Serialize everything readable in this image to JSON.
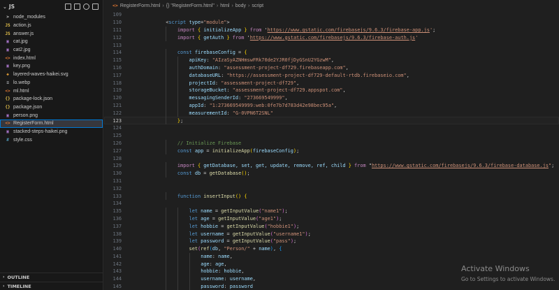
{
  "sidebar": {
    "folder": "JS",
    "files": [
      {
        "icon": ">",
        "kind": "folder",
        "name": "node_modules"
      },
      {
        "icon": "JS",
        "kind": "js",
        "name": "action.js"
      },
      {
        "icon": "JS",
        "kind": "js",
        "name": "answer.js"
      },
      {
        "icon": "▣",
        "kind": "img",
        "name": "cat.jpg"
      },
      {
        "icon": "▣",
        "kind": "img",
        "name": "cat2.jpg"
      },
      {
        "icon": "<>",
        "kind": "html",
        "name": "index.html"
      },
      {
        "icon": "▣",
        "kind": "img",
        "name": "key.png"
      },
      {
        "icon": "◈",
        "kind": "svg",
        "name": "layered-waves-haikei.svg"
      },
      {
        "icon": "≡",
        "kind": "generic",
        "name": "lo.webp"
      },
      {
        "icon": "<>",
        "kind": "html",
        "name": "ml.html"
      },
      {
        "icon": "{}",
        "kind": "json",
        "name": "package-lock.json"
      },
      {
        "icon": "{}",
        "kind": "json",
        "name": "package.json"
      },
      {
        "icon": "▣",
        "kind": "img",
        "name": "person.png"
      },
      {
        "icon": "<>",
        "kind": "html",
        "name": "RegisterForm.html",
        "active": true
      },
      {
        "icon": "▣",
        "kind": "img",
        "name": "stacked-steps-haikei.png"
      },
      {
        "icon": "#",
        "kind": "css",
        "name": "style.css"
      }
    ],
    "outline": "OUTLINE",
    "timeline": "TIMELINE"
  },
  "breadcrumb": {
    "file": "RegisterForm.html",
    "sym": "{} \"RegisterForm.html\"",
    "html": "html",
    "body": "body",
    "script": "script"
  },
  "code": {
    "current_line": 123,
    "lines": [
      {
        "n": 109,
        "indent": 0,
        "tokens": []
      },
      {
        "n": 110,
        "indent": 4,
        "tokens": [
          [
            "t-punc",
            "<"
          ],
          [
            "t-tag",
            "script"
          ],
          [
            "t-punc",
            " "
          ],
          [
            "t-attr",
            "type"
          ],
          [
            "t-punc",
            "="
          ],
          [
            "t-str",
            "\"module\""
          ],
          [
            "t-punc",
            ">"
          ]
        ]
      },
      {
        "n": 111,
        "indent": 6,
        "tokens": [
          [
            "t-kw",
            "import"
          ],
          [
            "t-punc",
            " "
          ],
          [
            "t-brk",
            "{"
          ],
          [
            "t-punc",
            " "
          ],
          [
            "t-var",
            "initializeApp"
          ],
          [
            "t-punc",
            " "
          ],
          [
            "t-brk",
            "}"
          ],
          [
            "t-punc",
            " "
          ],
          [
            "t-kw",
            "from"
          ],
          [
            "t-punc",
            " '"
          ],
          [
            "t-str link",
            "https://www.gstatic.com/firebasejs/9.6.3/firebase-app.js"
          ],
          [
            "t-str",
            "'"
          ],
          [
            "t-punc",
            ";"
          ]
        ]
      },
      {
        "n": 112,
        "indent": 6,
        "tokens": [
          [
            "t-kw",
            "import"
          ],
          [
            "t-punc",
            " "
          ],
          [
            "t-brk",
            "{"
          ],
          [
            "t-punc",
            " "
          ],
          [
            "t-var",
            "getAuth"
          ],
          [
            "t-punc",
            " "
          ],
          [
            "t-brk",
            "}"
          ],
          [
            "t-punc",
            " "
          ],
          [
            "t-kw",
            "from"
          ],
          [
            "t-punc",
            " '"
          ],
          [
            "t-str link",
            "https://www.gstatic.com/firebasejs/9.6.3/firebase-auth.js"
          ],
          [
            "t-str",
            "'"
          ]
        ]
      },
      {
        "n": 113,
        "indent": 0,
        "tokens": []
      },
      {
        "n": 114,
        "indent": 6,
        "tokens": [
          [
            "t-dec",
            "const"
          ],
          [
            "t-punc",
            " "
          ],
          [
            "t-var",
            "firebaseConfig"
          ],
          [
            "t-punc",
            " = "
          ],
          [
            "t-brk",
            "{"
          ]
        ]
      },
      {
        "n": 115,
        "indent": 8,
        "tokens": [
          [
            "t-var",
            "apiKey"
          ],
          [
            "t-punc",
            ": "
          ],
          [
            "t-str",
            "\"AIzaSyAZNHmswFRk70de2YJR0fjDyGSnU2YGzwM\""
          ],
          [
            "t-punc",
            ","
          ]
        ]
      },
      {
        "n": 116,
        "indent": 8,
        "tokens": [
          [
            "t-var",
            "authDomain"
          ],
          [
            "t-punc",
            ": "
          ],
          [
            "t-str",
            "\"assessment-project-df729.firebaseapp.com\""
          ],
          [
            "t-punc",
            ","
          ]
        ]
      },
      {
        "n": 117,
        "indent": 8,
        "tokens": [
          [
            "t-var",
            "databaseURL"
          ],
          [
            "t-punc",
            ": "
          ],
          [
            "t-str",
            "\"https://assessment-project-df729-default-rtdb.firebaseio.com\""
          ],
          [
            "t-punc",
            ","
          ]
        ]
      },
      {
        "n": 118,
        "indent": 8,
        "tokens": [
          [
            "t-var",
            "projectId"
          ],
          [
            "t-punc",
            ": "
          ],
          [
            "t-str",
            "\"assessment-project-df729\""
          ],
          [
            "t-punc",
            ","
          ]
        ]
      },
      {
        "n": 119,
        "indent": 8,
        "tokens": [
          [
            "t-var",
            "storageBucket"
          ],
          [
            "t-punc",
            ": "
          ],
          [
            "t-str",
            "\"assessment-project-df729.appspot.com\""
          ],
          [
            "t-punc",
            ","
          ]
        ]
      },
      {
        "n": 120,
        "indent": 8,
        "tokens": [
          [
            "t-var",
            "messagingSenderId"
          ],
          [
            "t-punc",
            ": "
          ],
          [
            "t-str",
            "\"273669549999\""
          ],
          [
            "t-punc",
            ","
          ]
        ]
      },
      {
        "n": 121,
        "indent": 8,
        "tokens": [
          [
            "t-var",
            "appId"
          ],
          [
            "t-punc",
            ": "
          ],
          [
            "t-str",
            "\"1:273669549999:web:0fe7b7d783d42e98bec95a\""
          ],
          [
            "t-punc",
            ","
          ]
        ]
      },
      {
        "n": 122,
        "indent": 8,
        "tokens": [
          [
            "t-var",
            "measurementId"
          ],
          [
            "t-punc",
            ": "
          ],
          [
            "t-str",
            "\"G-0VPN6T2SNL\""
          ]
        ]
      },
      {
        "n": 123,
        "indent": 6,
        "tokens": [
          [
            "t-brk",
            "}"
          ],
          [
            "t-punc",
            ";"
          ]
        ]
      },
      {
        "n": 124,
        "indent": 0,
        "tokens": []
      },
      {
        "n": 125,
        "indent": 0,
        "tokens": []
      },
      {
        "n": 126,
        "indent": 6,
        "tokens": [
          [
            "t-com",
            "// Initialize Firebase"
          ]
        ]
      },
      {
        "n": 127,
        "indent": 6,
        "tokens": [
          [
            "t-dec",
            "const"
          ],
          [
            "t-punc",
            " "
          ],
          [
            "t-var",
            "app"
          ],
          [
            "t-punc",
            " = "
          ],
          [
            "t-fn",
            "initializeApp"
          ],
          [
            "t-brk",
            "("
          ],
          [
            "t-var",
            "firebaseConfig"
          ],
          [
            "t-brk",
            ")"
          ],
          [
            "t-punc",
            ";"
          ]
        ]
      },
      {
        "n": 128,
        "indent": 0,
        "tokens": []
      },
      {
        "n": 129,
        "indent": 6,
        "tokens": [
          [
            "t-kw",
            "import"
          ],
          [
            "t-punc",
            " "
          ],
          [
            "t-brk",
            "{"
          ],
          [
            "t-punc",
            " "
          ],
          [
            "t-var",
            "getDatabase, set, get, update, remove, ref, child"
          ],
          [
            "t-punc",
            " "
          ],
          [
            "t-brk",
            "}"
          ],
          [
            "t-punc",
            " "
          ],
          [
            "t-kw",
            "from"
          ],
          [
            "t-punc",
            " \""
          ],
          [
            "t-str link",
            "https://www.gstatic.com/firebasejs/9.6.3/firebase-database.js"
          ],
          [
            "t-str",
            "\""
          ],
          [
            "t-punc",
            ";"
          ]
        ]
      },
      {
        "n": 130,
        "indent": 6,
        "tokens": [
          [
            "t-dec",
            "const"
          ],
          [
            "t-punc",
            " "
          ],
          [
            "t-var",
            "db"
          ],
          [
            "t-punc",
            " = "
          ],
          [
            "t-fn",
            "getDatabase"
          ],
          [
            "t-brk",
            "()"
          ],
          [
            "t-punc",
            ";"
          ]
        ]
      },
      {
        "n": 131,
        "indent": 0,
        "tokens": []
      },
      {
        "n": 132,
        "indent": 0,
        "tokens": []
      },
      {
        "n": 133,
        "indent": 6,
        "tokens": [
          [
            "t-dec",
            "function"
          ],
          [
            "t-punc",
            " "
          ],
          [
            "t-fn",
            "insertInput"
          ],
          [
            "t-brk",
            "()"
          ],
          [
            "t-punc",
            " "
          ],
          [
            "t-brk",
            "{"
          ]
        ]
      },
      {
        "n": 134,
        "indent": 0,
        "tokens": []
      },
      {
        "n": 135,
        "indent": 8,
        "tokens": [
          [
            "t-dec",
            "let"
          ],
          [
            "t-punc",
            " "
          ],
          [
            "t-var",
            "name"
          ],
          [
            "t-punc",
            " = "
          ],
          [
            "t-fn",
            "getInputValue"
          ],
          [
            "t-brk2",
            "("
          ],
          [
            "t-str",
            "\"name1\""
          ],
          [
            "t-brk2",
            ")"
          ],
          [
            "t-punc",
            ";"
          ]
        ]
      },
      {
        "n": 136,
        "indent": 8,
        "tokens": [
          [
            "t-dec",
            "let"
          ],
          [
            "t-punc",
            " "
          ],
          [
            "t-var",
            "age"
          ],
          [
            "t-punc",
            " = "
          ],
          [
            "t-fn",
            "getInputValue"
          ],
          [
            "t-brk2",
            "("
          ],
          [
            "t-str",
            "\"age1\""
          ],
          [
            "t-brk2",
            ")"
          ],
          [
            "t-punc",
            ";"
          ]
        ]
      },
      {
        "n": 137,
        "indent": 8,
        "tokens": [
          [
            "t-dec",
            "let"
          ],
          [
            "t-punc",
            " "
          ],
          [
            "t-var",
            "hobbie"
          ],
          [
            "t-punc",
            " = "
          ],
          [
            "t-fn",
            "getInputValue"
          ],
          [
            "t-brk2",
            "("
          ],
          [
            "t-str",
            "\"hobbie1\""
          ],
          [
            "t-brk2",
            ")"
          ],
          [
            "t-punc",
            ";"
          ]
        ]
      },
      {
        "n": 138,
        "indent": 8,
        "tokens": [
          [
            "t-dec",
            "let"
          ],
          [
            "t-punc",
            " "
          ],
          [
            "t-var",
            "username"
          ],
          [
            "t-punc",
            " = "
          ],
          [
            "t-fn",
            "getInputValue"
          ],
          [
            "t-brk2",
            "("
          ],
          [
            "t-str",
            "\"username1\""
          ],
          [
            "t-brk2",
            ")"
          ],
          [
            "t-punc",
            ";"
          ]
        ]
      },
      {
        "n": 139,
        "indent": 8,
        "tokens": [
          [
            "t-dec",
            "let"
          ],
          [
            "t-punc",
            " "
          ],
          [
            "t-var",
            "password"
          ],
          [
            "t-punc",
            " = "
          ],
          [
            "t-fn",
            "getInputValue"
          ],
          [
            "t-brk2",
            "("
          ],
          [
            "t-str",
            "\"pass\""
          ],
          [
            "t-brk2",
            ")"
          ],
          [
            "t-punc",
            ";"
          ]
        ]
      },
      {
        "n": 140,
        "indent": 8,
        "tokens": [
          [
            "t-fn",
            "set"
          ],
          [
            "t-brk2",
            "("
          ],
          [
            "t-fn",
            "ref"
          ],
          [
            "t-brk3",
            "("
          ],
          [
            "t-var",
            "db"
          ],
          [
            "t-punc",
            ", "
          ],
          [
            "t-str",
            "\"Person/\""
          ],
          [
            "t-punc",
            " + "
          ],
          [
            "t-var",
            "name"
          ],
          [
            "t-brk3",
            ")"
          ],
          [
            "t-punc",
            ", "
          ],
          [
            "t-brk3",
            "{"
          ]
        ]
      },
      {
        "n": 141,
        "indent": 10,
        "tokens": [
          [
            "t-var",
            "name"
          ],
          [
            "t-punc",
            ": "
          ],
          [
            "t-var",
            "name"
          ],
          [
            "t-punc",
            ","
          ]
        ]
      },
      {
        "n": 142,
        "indent": 10,
        "tokens": [
          [
            "t-var",
            "age"
          ],
          [
            "t-punc",
            ": "
          ],
          [
            "t-var",
            "age"
          ],
          [
            "t-punc",
            ","
          ]
        ]
      },
      {
        "n": 143,
        "indent": 10,
        "tokens": [
          [
            "t-var",
            "hobbie"
          ],
          [
            "t-punc",
            ": "
          ],
          [
            "t-var",
            "hobbie"
          ],
          [
            "t-punc",
            ","
          ]
        ]
      },
      {
        "n": 144,
        "indent": 10,
        "tokens": [
          [
            "t-var",
            "username"
          ],
          [
            "t-punc",
            ": "
          ],
          [
            "t-var",
            "username"
          ],
          [
            "t-punc",
            ","
          ]
        ]
      },
      {
        "n": 145,
        "indent": 10,
        "tokens": [
          [
            "t-var",
            "password"
          ],
          [
            "t-punc",
            ": "
          ],
          [
            "t-var",
            "password"
          ]
        ]
      },
      {
        "n": 146,
        "indent": 0,
        "tokens": []
      }
    ]
  },
  "watermark": {
    "title": "Activate Windows",
    "subtitle": "Go to Settings to activate Windows."
  }
}
